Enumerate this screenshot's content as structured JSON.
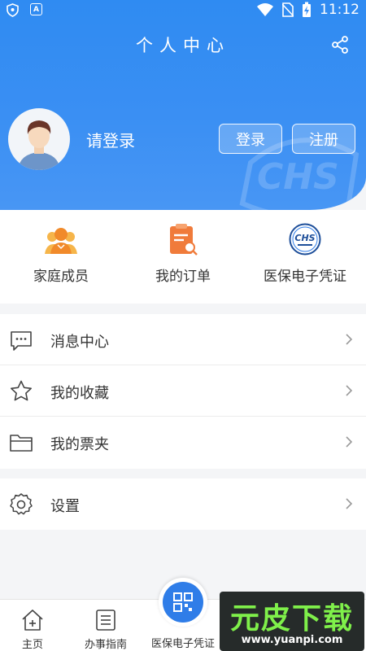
{
  "status_bar": {
    "time": "11:12"
  },
  "header": {
    "title": "个人中心",
    "login_prompt": "请登录",
    "login_button": "登录",
    "register_button": "注册",
    "watermark_text": "CHS"
  },
  "shortcuts": [
    {
      "label": "家庭成员",
      "icon": "family-members-icon"
    },
    {
      "label": "我的订单",
      "icon": "my-orders-icon"
    },
    {
      "label": "医保电子凭证",
      "icon": "chs-voucher-icon",
      "icon_text": "CHS"
    }
  ],
  "menu_group_1": [
    {
      "label": "消息中心",
      "icon": "message-icon"
    },
    {
      "label": "我的收藏",
      "icon": "star-icon"
    },
    {
      "label": "我的票夹",
      "icon": "folder-icon"
    }
  ],
  "menu_group_2": [
    {
      "label": "设置",
      "icon": "gear-icon"
    }
  ],
  "bottom_nav": {
    "home": "主页",
    "guide": "办事指南",
    "voucher": "医保电子凭证"
  },
  "watermark": {
    "title": "元皮下载",
    "url": "www.yuanpi.com"
  },
  "colors": {
    "primary": "#2f8bf2",
    "orange": "#f28b3a",
    "fab": "#2f7de8"
  }
}
